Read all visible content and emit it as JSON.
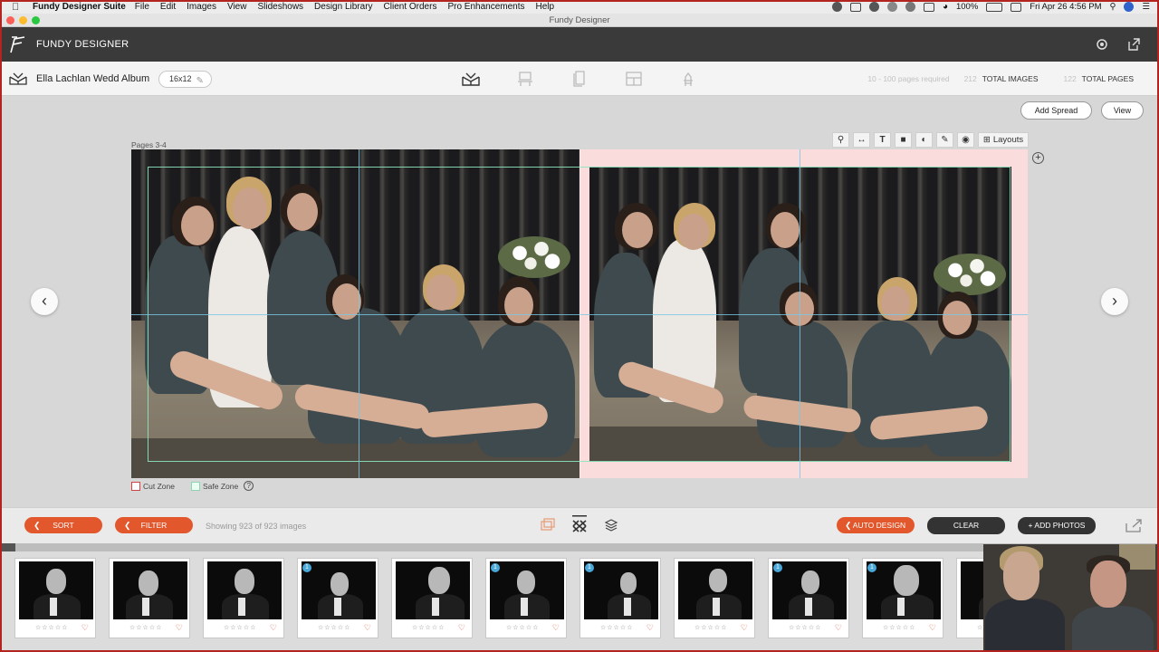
{
  "menubar": {
    "app": "Fundy Designer Suite",
    "items": [
      "File",
      "Edit",
      "Images",
      "View",
      "Slideshows",
      "Design Library",
      "Client Orders",
      "Pro Enhancements",
      "Help"
    ],
    "battery": "100%",
    "clock": "Fri Apr 26  4:56 PM"
  },
  "window": {
    "title": "Fundy Designer"
  },
  "header": {
    "brand": "FUNDY DESIGNER"
  },
  "project": {
    "album_name": "Ella Lachlan Wedd Album",
    "size": "16x12",
    "pages_required": "10 - 100 pages required",
    "total_images_count": "212",
    "total_images_label": "TOTAL IMAGES",
    "total_pages_count": "122",
    "total_pages_label": "TOTAL PAGES"
  },
  "workspace": {
    "add_spread": "Add Spread",
    "view": "View",
    "pages_label": "Pages 3-4",
    "layouts": "Layouts",
    "cut_zone": "Cut Zone",
    "safe_zone": "Safe Zone"
  },
  "toolbar": {
    "sort": "SORT",
    "filter": "FILTER",
    "showing": "Showing 923 of 923 images",
    "auto_design": "AUTO DESIGN",
    "clear": "CLEAR",
    "add_photos": "+ ADD PHOTOS"
  },
  "filmstrip": {
    "progress": 0.012,
    "stars": "☆☆☆☆☆",
    "badge": "1",
    "thumbs": [
      {
        "badge": false
      },
      {
        "badge": false
      },
      {
        "badge": false
      },
      {
        "badge": true
      },
      {
        "badge": false
      },
      {
        "badge": true
      },
      {
        "badge": true
      },
      {
        "badge": false
      },
      {
        "badge": true
      },
      {
        "badge": true
      },
      {
        "badge": false
      }
    ]
  },
  "colors": {
    "accent": "#e2572b",
    "header": "#3a3a3a",
    "dark_button": "#333333",
    "badge": "#4aa8d9"
  }
}
